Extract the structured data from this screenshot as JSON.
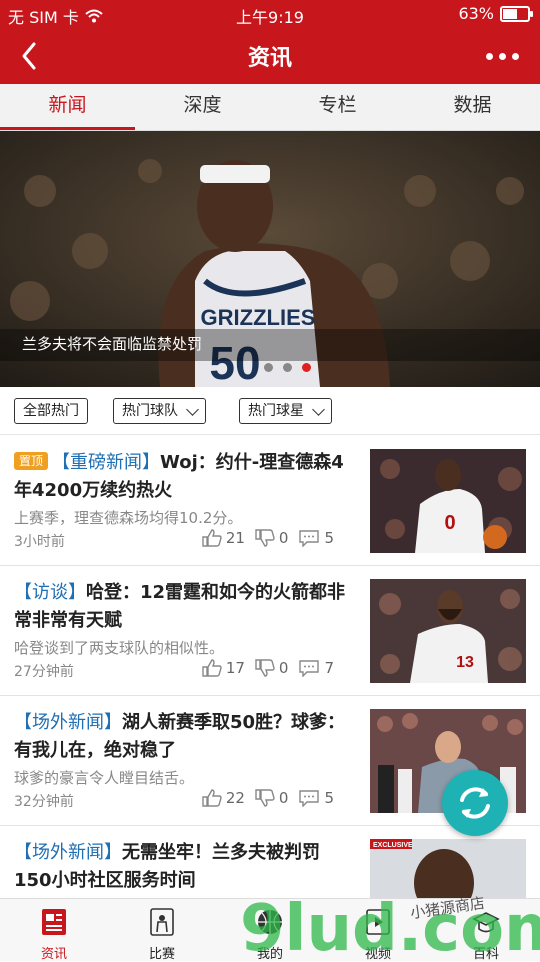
{
  "status": {
    "carrier": "无 SIM 卡",
    "time": "上午9:19",
    "battery": "63%",
    "battery_level": 0.63
  },
  "header": {
    "title": "资讯"
  },
  "tabs": [
    {
      "label": "新闻",
      "active": true
    },
    {
      "label": "深度",
      "active": false
    },
    {
      "label": "专栏",
      "active": false
    },
    {
      "label": "数据",
      "active": false
    }
  ],
  "banner": {
    "caption": "兰多夫将不会面临监禁处罚",
    "jersey_text": "GRIZZLIES",
    "jersey_number": "50",
    "slide_count": 3,
    "active_slide": 3
  },
  "filters": {
    "all": "全部热门",
    "teams": "热门球队",
    "players": "热门球星"
  },
  "news": [
    {
      "pin": "置顶",
      "tag": "【重磅新闻】",
      "title": "Woj：约什-理查德森4年4200万续约热火",
      "summary": "上赛季，理查德森场均得10.2分。",
      "time": "3小时前",
      "likes": "21",
      "dislikes": "0",
      "comments": "5",
      "thumb_number": "0"
    },
    {
      "pin": "",
      "tag": "【访谈】",
      "title": "哈登：12雷霆和如今的火箭都非常非常有天赋",
      "summary": "哈登谈到了两支球队的相似性。",
      "time": "27分钟前",
      "likes": "17",
      "dislikes": "0",
      "comments": "7",
      "thumb_number": "13"
    },
    {
      "pin": "",
      "tag": "【场外新闻】",
      "title": "湖人新赛季取50胜？球爹：有我儿在，绝对稳了",
      "summary": "球爹的豪言令人瞠目结舌。",
      "time": "32分钟前",
      "likes": "22",
      "dislikes": "0",
      "comments": "5"
    },
    {
      "pin": "",
      "tag": "【场外新闻】",
      "title": "无需坐牢！兰多夫被判罚150小时社区服务时间",
      "summary": "",
      "time": "",
      "thumb_badge": "EXCLUSIVE"
    }
  ],
  "bottom_nav": [
    {
      "label": "资讯",
      "active": true
    },
    {
      "label": "比赛",
      "active": false
    },
    {
      "label": "我的",
      "active": false
    },
    {
      "label": "视频",
      "active": false
    },
    {
      "label": "百科",
      "active": false
    }
  ],
  "watermark": {
    "logo": "9lud.com",
    "text": "小猪源商店"
  },
  "colors": {
    "brand": "#c8161d",
    "tag": "#1f6fb5",
    "pin": "#f0a020",
    "refresh": "#1fb2b5"
  }
}
